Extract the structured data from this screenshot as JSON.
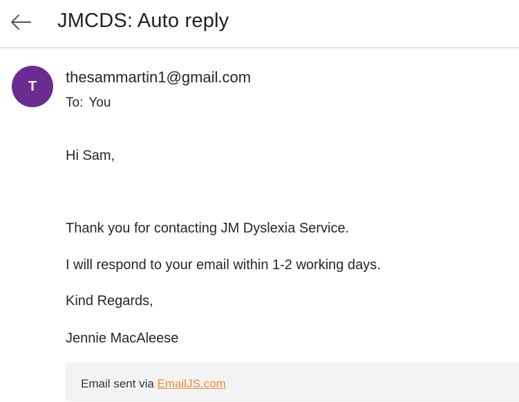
{
  "header": {
    "back_icon": "back-arrow-icon",
    "title": "JMCDS: Auto reply"
  },
  "message": {
    "avatar_initial": "T",
    "avatar_color": "#6b2c91",
    "sender": "thesammartin1@gmail.com",
    "to_label": "To:",
    "to_value": "You",
    "body": {
      "greeting": "Hi Sam,",
      "line1": "Thank you for contacting JM Dyslexia Service.",
      "line2": "I will respond to your email within 1-2 working days.",
      "closing": "Kind Regards,",
      "signature": "Jennie MacAleese"
    },
    "footer": {
      "prefix": "Email sent via",
      "link_text": "EmailJS.com",
      "link_color": "#f0883a"
    }
  }
}
